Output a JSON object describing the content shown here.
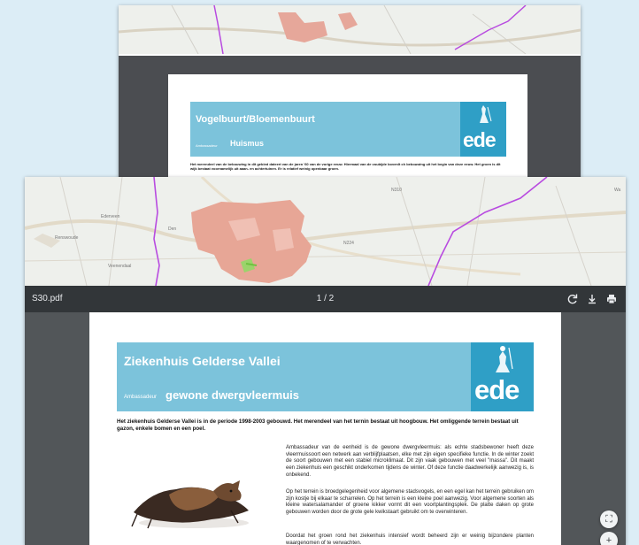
{
  "back_window": {
    "page": {
      "title": "Vogelbuurt/Bloemenbuurt",
      "ambassador_label": "Ambassadeur",
      "ambassador_species": "Huismus",
      "intro": "Het merendeel van de bebouwing in dit gebied dateert van de jaren '60 van de vorige eeuw. Hiermaal van de voubijde bovenlt ch bebouwing uit het begin van deze eeuw. Het groen is dit wijk bestaat voornamelijk uit aaan- en achtertuinen. Er is relatief weinig openbaar groen.",
      "logo_text": "ede"
    }
  },
  "front_window": {
    "map_labels": {
      "ederveen": "Ederveen",
      "renswoude": "Renswoude",
      "veenendaal": "Veenendaal",
      "wageningen": "Wa",
      "n224": "N224",
      "n310": "N310",
      "den": "Den"
    },
    "pdf_toolbar": {
      "filename": "S30.pdf",
      "page_indicator": "1 / 2"
    },
    "page": {
      "title": "Ziekenhuis Gelderse Vallei",
      "ambassador_label": "Ambassadeur",
      "ambassador_species": "gewone dwergvleermuis",
      "logo_text": "ede",
      "intro": "Het ziekenhuis Gelderse Vallei is in de periode 1998-2003 gebouwd. Het merendeel van het ternin bestaat uit hoogbouw. Het omliggende terrein bestaat uit gazon, enkele bomen en een poel.",
      "paragraphs": [
        "Ambassadeur van de eenheid is de gewone dwergvleermuis: als echte stadsbewoner heeft deze vleermuissoort een netwerk aan verblijfplaatsen, elke met zijn eigen specifieke functie. In de winter zoekt de soort gebouwen met een stabiel microklimaat. Dit zijn vaak gebouwen met veel \"massa\". Dit maakt een ziekenhuis een geschikt onderkomen tijdens de winter. Of deze functie daadwerkelijk aanwezig is, is onbekend.",
        "Op het terrein is broedgelegenheid voor algemene stadsvogels, en een egel kan het terrein gebruiken om zijn kostje bij elkaar te scharrelen. Op het terrein is een kleine poel aanwezig. Voor algemene soorten als kleine watersalamander of groene kikker vormt dit een voortplantingsplek. De platte daken op grote gebouwen worden door de grote gele kwikstaart gebruikt om te overwinteren.",
        "Doordat het groen rond het ziekenhuis intensief wordt beheerd zijn er weinig bijzondere planten waargenomen of te verwachten."
      ]
    },
    "fab": {
      "fit_glyph": "⛶",
      "zoom_in_glyph": "+"
    }
  }
}
